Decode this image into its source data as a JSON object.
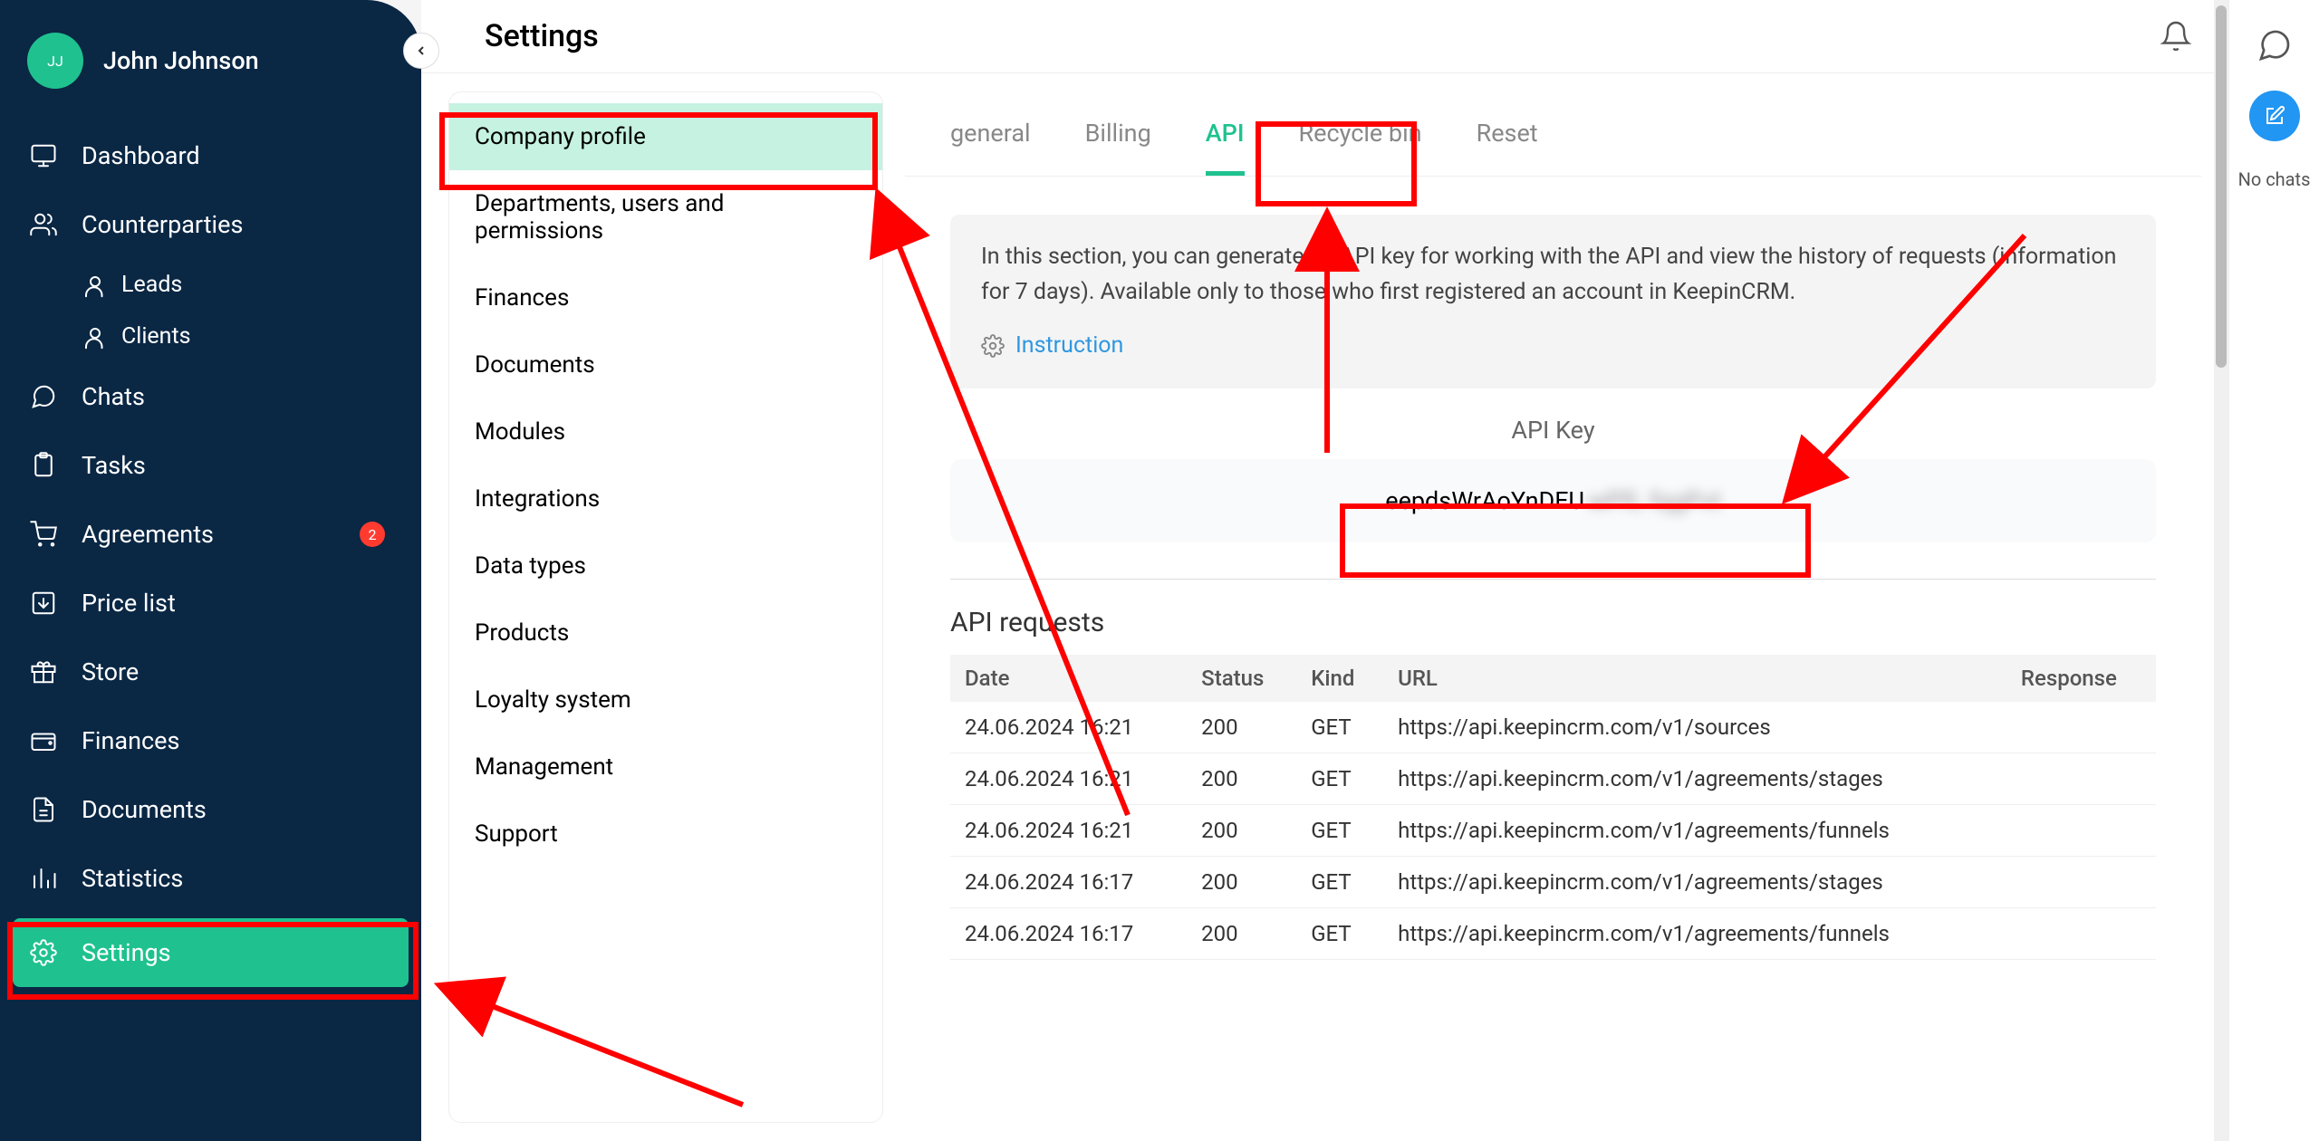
{
  "user": {
    "initials": "JJ",
    "name": "John Johnson"
  },
  "sidebar": {
    "items": [
      {
        "label": "Dashboard",
        "icon": "monitor"
      },
      {
        "label": "Counterparties",
        "icon": "users",
        "subs": [
          {
            "label": "Leads",
            "icon": "person-mini"
          },
          {
            "label": "Clients",
            "icon": "person-mini"
          }
        ]
      },
      {
        "label": "Chats",
        "icon": "chat"
      },
      {
        "label": "Tasks",
        "icon": "clipboard"
      },
      {
        "label": "Agreements",
        "icon": "cart",
        "badge": "2"
      },
      {
        "label": "Price list",
        "icon": "download-box"
      },
      {
        "label": "Store",
        "icon": "gift"
      },
      {
        "label": "Finances",
        "icon": "wallet"
      },
      {
        "label": "Documents",
        "icon": "docs"
      },
      {
        "label": "Statistics",
        "icon": "bars"
      },
      {
        "label": "Settings",
        "icon": "gear",
        "active": true
      }
    ]
  },
  "header": {
    "page_title": "Settings"
  },
  "settings_menu": [
    "Company profile",
    "Departments, users and permissions",
    "Finances",
    "Documents",
    "Modules",
    "Integrations",
    "Data types",
    "Products",
    "Loyalty system",
    "Management",
    "Support"
  ],
  "settings_menu_active": 0,
  "tabs": [
    "general",
    "Billing",
    "API",
    "Recycle bin",
    "Reset"
  ],
  "tabs_active": 2,
  "info_text": "In this section, you can generate an API key for working with the API and view the history of requests (information for 7 days). Available only to those who first registered an account in KeepinCRM.",
  "instruction_label": "Instruction",
  "apikey": {
    "label": "API Key",
    "visible_part": "eepdsWrAoYnDEU",
    "blurred_part": "wPfL fqgPvt"
  },
  "requests": {
    "title": "API requests",
    "columns": [
      "Date",
      "Status",
      "Kind",
      "URL",
      "Response"
    ],
    "rows": [
      {
        "date": "24.06.2024 16:21",
        "status": "200",
        "kind": "GET",
        "url": "https://api.keepincrm.com/v1/sources",
        "response": ""
      },
      {
        "date": "24.06.2024 16:21",
        "status": "200",
        "kind": "GET",
        "url": "https://api.keepincrm.com/v1/agreements/stages",
        "response": ""
      },
      {
        "date": "24.06.2024 16:21",
        "status": "200",
        "kind": "GET",
        "url": "https://api.keepincrm.com/v1/agreements/funnels",
        "response": ""
      },
      {
        "date": "24.06.2024 16:17",
        "status": "200",
        "kind": "GET",
        "url": "https://api.keepincrm.com/v1/agreements/stages",
        "response": ""
      },
      {
        "date": "24.06.2024 16:17",
        "status": "200",
        "kind": "GET",
        "url": "https://api.keepincrm.com/v1/agreements/funnels",
        "response": ""
      }
    ]
  },
  "rightrail": {
    "no_chats": "No chats"
  }
}
